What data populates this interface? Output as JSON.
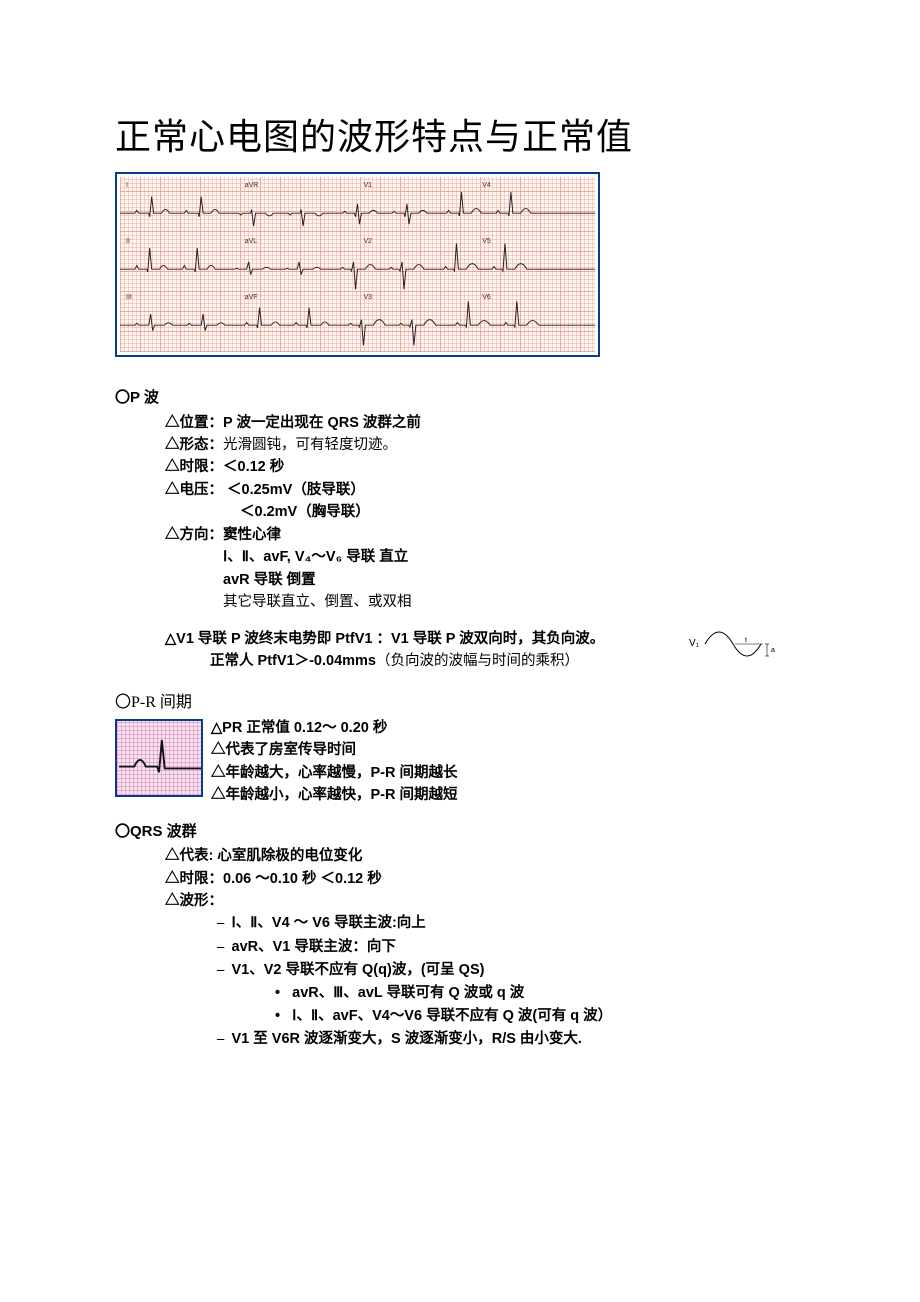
{
  "title": "正常心电图的波形特点与正常值",
  "ecg_leads": {
    "row1": [
      "I",
      "aVR",
      "V1",
      "V4"
    ],
    "row2": [
      "II",
      "aVL",
      "V2",
      "V5"
    ],
    "row3": [
      "III",
      "aVF",
      "V3",
      "V6"
    ]
  },
  "p_wave": {
    "head": "〇P 波",
    "l1": "△位置：P 波一定出现在 QRS 波群之前",
    "l2_a": "△形态：",
    "l2_b": "光滑圆钝，可有轻度切迹。",
    "l3": "△时限：＜0.12 秒",
    "l4": "△电压：  ＜0.25mV（肢导联）",
    "l5": "＜0.2mV（胸导联）",
    "l6": "△方向：窦性心律",
    "l7": "Ⅰ、Ⅱ、avF, V₄～V₆ 导联  直立",
    "l8": "avR 导联      倒置",
    "l9_a": "其它导联直立、倒置、或双相",
    "l10": "△V1 导联 P 波终末电势即 PtfV1 ：V1 导联 P 波双向时，其负向波。",
    "l11_a": "正常人 PtfV1＞-0.04mms",
    "l11_b": "（负向波的波幅与时间的乘积）",
    "ptf_label": "V₁"
  },
  "pr_interval": {
    "head": "〇P-R 间期",
    "l1": "△PR 正常值 0.12～  0.20 秒",
    "l2": "△代表了房室传导时间",
    "l3": "△年龄越大，心率越慢，P-R 间期越长",
    "l4": "△年龄越小，心率越快，P-R 间期越短"
  },
  "qrs": {
    "head": "〇QRS 波群",
    "l1": "△代表: 心室肌除极的电位变化",
    "l2": "△时限：0.06 ～0.10 秒    ＜0.12 秒",
    "l3": "△波形：",
    "d1": "Ⅰ、Ⅱ、V4 ～ V6 导联主波:向上",
    "d2": "avR、V1 导联主波：向下",
    "d3": "V1、V2 导联不应有 Q(q)波，(可呈 QS)",
    "b1": "avR、Ⅲ、avL 导联可有 Q 波或 q 波",
    "b2": "Ⅰ、Ⅱ、avF、V4～V6 导联不应有 Q 波(可有 q 波）",
    "d4": "V1 至 V6R 波逐渐变大，S 波逐渐变小，R/S 由小变大."
  }
}
